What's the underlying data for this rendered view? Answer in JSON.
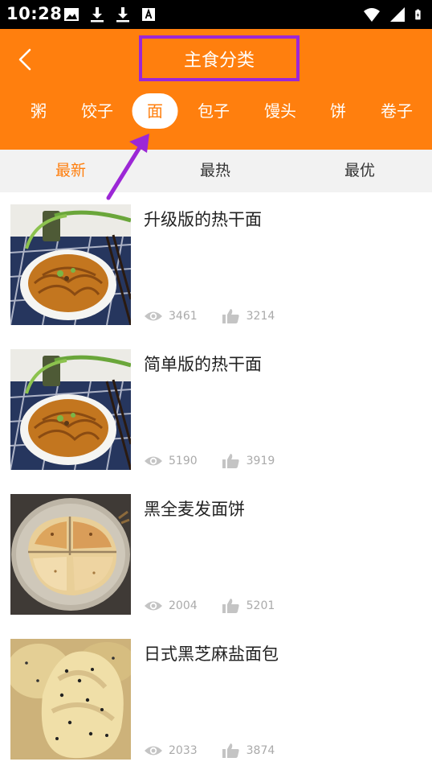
{
  "status_bar": {
    "time": "10:28",
    "left_icons": [
      "image-icon",
      "download-icon",
      "download-icon",
      "keyboard-a-icon"
    ],
    "right_icons": [
      "wifi-icon",
      "signal-icon",
      "battery-charging-icon"
    ]
  },
  "header": {
    "title": "主食分类",
    "back_icon": "chevron-left-icon",
    "background_color": "#ff7f0e",
    "highlight_box_color": "#9c27d6"
  },
  "categories": [
    {
      "label": "粥",
      "active": false
    },
    {
      "label": "饺子",
      "active": false
    },
    {
      "label": "面",
      "active": true
    },
    {
      "label": "包子",
      "active": false
    },
    {
      "label": "馒头",
      "active": false
    },
    {
      "label": "饼",
      "active": false
    },
    {
      "label": "卷子",
      "active": false
    }
  ],
  "sort_tabs": [
    {
      "label": "最新",
      "active": true
    },
    {
      "label": "最热",
      "active": false
    },
    {
      "label": "最优",
      "active": false
    }
  ],
  "recipes": [
    {
      "title": "升级版的热干面",
      "views": "3461",
      "likes": "3214",
      "image": "hot-dry-noodles-photo"
    },
    {
      "title": "简单版的热干面",
      "views": "5190",
      "likes": "3919",
      "image": "hot-dry-noodles-photo"
    },
    {
      "title": "黑全麦发面饼",
      "views": "2004",
      "likes": "5201",
      "image": "flatbread-photo"
    },
    {
      "title": "日式黑芝麻盐面包",
      "views": "2033",
      "likes": "3874",
      "image": "sesame-bread-photo"
    }
  ],
  "accent_color": "#ff7f0e",
  "annotation_arrow_color": "#9c27d6"
}
